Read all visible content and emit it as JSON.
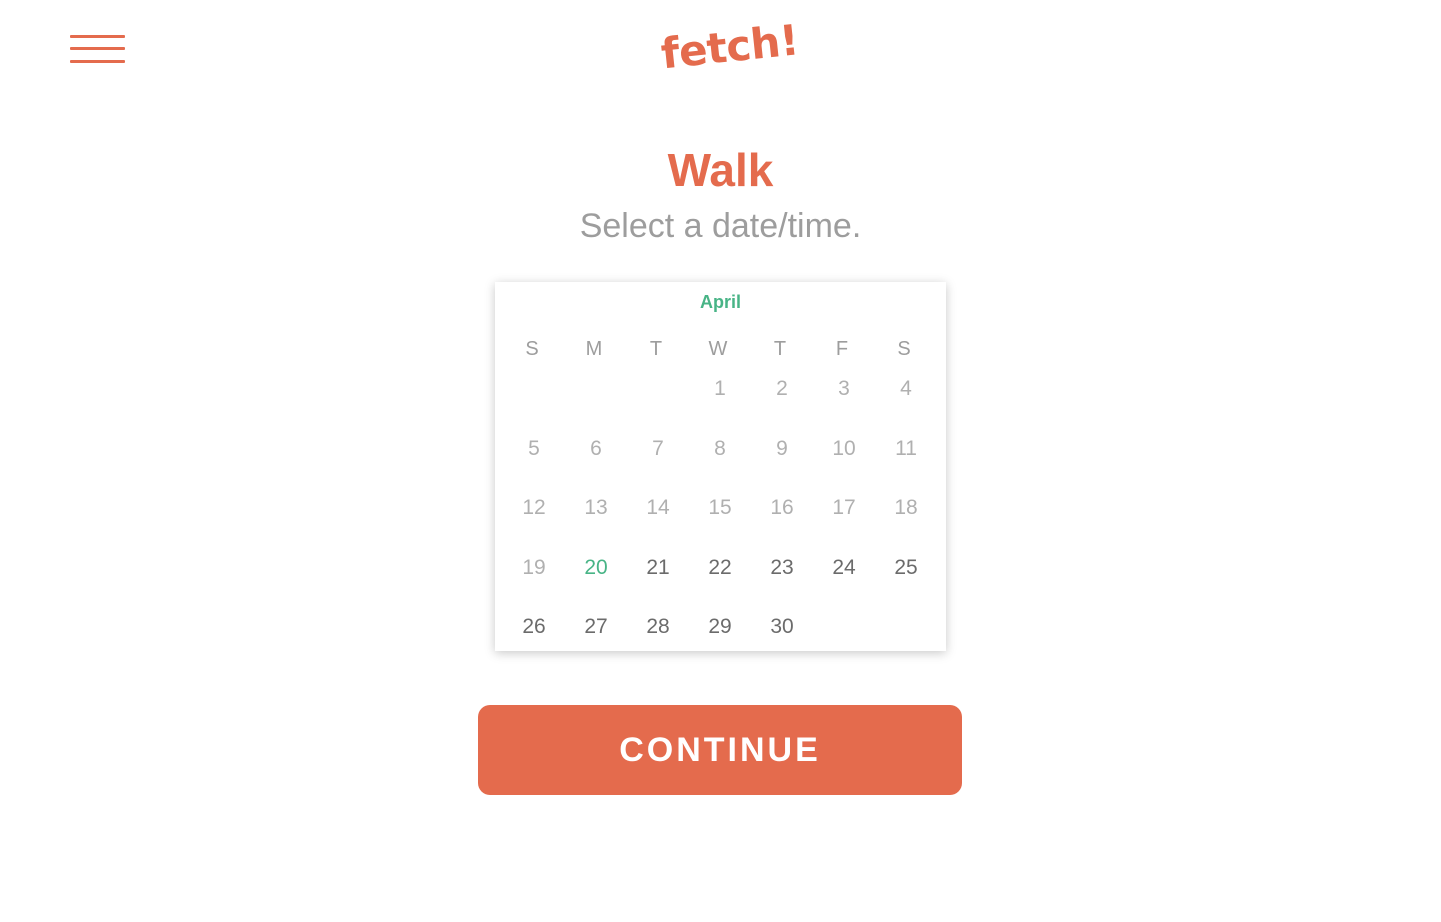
{
  "header": {
    "logo_text": "fetch!",
    "menu_icon": "hamburger-menu-icon"
  },
  "main": {
    "title": "Walk",
    "subtitle": "Select a date/time."
  },
  "calendar": {
    "month": "April",
    "weekdays": [
      "S",
      "M",
      "T",
      "W",
      "T",
      "F",
      "S"
    ],
    "leading_blanks": 3,
    "days": [
      {
        "label": "1",
        "state": "past"
      },
      {
        "label": "2",
        "state": "past"
      },
      {
        "label": "3",
        "state": "past"
      },
      {
        "label": "4",
        "state": "past"
      },
      {
        "label": "5",
        "state": "past"
      },
      {
        "label": "6",
        "state": "past"
      },
      {
        "label": "7",
        "state": "past"
      },
      {
        "label": "8",
        "state": "past"
      },
      {
        "label": "9",
        "state": "past"
      },
      {
        "label": "10",
        "state": "past"
      },
      {
        "label": "11",
        "state": "past"
      },
      {
        "label": "12",
        "state": "past"
      },
      {
        "label": "13",
        "state": "past"
      },
      {
        "label": "14",
        "state": "past"
      },
      {
        "label": "15",
        "state": "past"
      },
      {
        "label": "16",
        "state": "past"
      },
      {
        "label": "17",
        "state": "past"
      },
      {
        "label": "18",
        "state": "past"
      },
      {
        "label": "19",
        "state": "past"
      },
      {
        "label": "20",
        "state": "today"
      },
      {
        "label": "21",
        "state": "available"
      },
      {
        "label": "22",
        "state": "available"
      },
      {
        "label": "23",
        "state": "available"
      },
      {
        "label": "24",
        "state": "available"
      },
      {
        "label": "25",
        "state": "available"
      },
      {
        "label": "26",
        "state": "available"
      },
      {
        "label": "27",
        "state": "available"
      },
      {
        "label": "28",
        "state": "available"
      },
      {
        "label": "29",
        "state": "available"
      },
      {
        "label": "30",
        "state": "available"
      }
    ]
  },
  "actions": {
    "continue_label": "CONTINUE"
  },
  "colors": {
    "brand": "#e46b4d",
    "accent": "#48b486",
    "muted_text": "#9d9d9d",
    "active_day": "#6b6b6b"
  }
}
